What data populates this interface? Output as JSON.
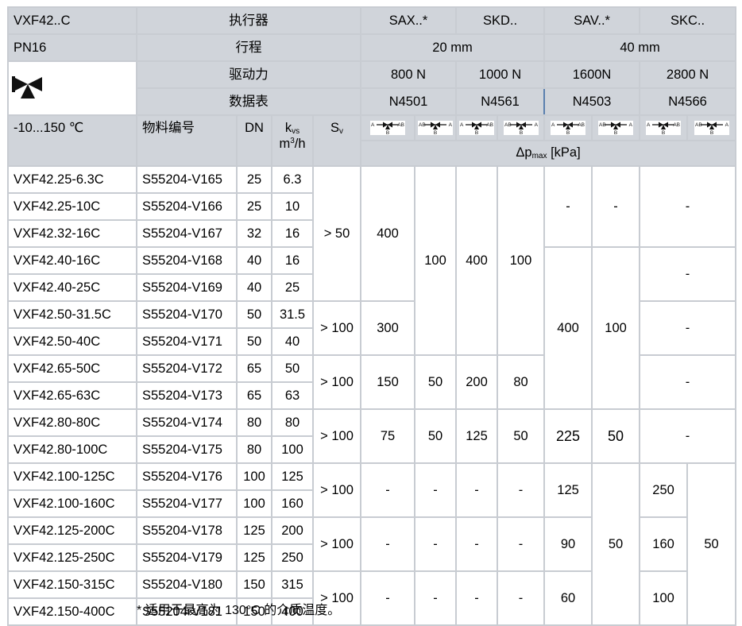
{
  "header": {
    "model": "VXF42..C",
    "actuator_label": "执行器",
    "actuators": [
      "SAX..*",
      "SKD..",
      "SAV..*",
      "SKC.."
    ],
    "pn": "PN16",
    "stroke_label": "行程",
    "strokes": [
      "20 mm",
      "40 mm"
    ],
    "force_label": "驱动力",
    "forces": [
      "800 N",
      "1000 N",
      "1600N",
      "2800 N"
    ],
    "datasheet_label": "数据表",
    "datasheets": [
      "N4501",
      "N4561",
      "N4503",
      "N4566"
    ]
  },
  "columns": {
    "temp": "-10...150 ℃",
    "material": "物料编号",
    "dn": "DN",
    "kvs_main": "k",
    "kvs_sub": "vs",
    "kvs_unit_main": "m",
    "kvs_unit_sup": "3",
    "kvs_unit_tail": "/h",
    "sv_main": "S",
    "sv_sub": "v",
    "dp_delta": "Δp",
    "dp_sub": "max",
    "dp_unit": " [kPa]"
  },
  "flow_icons": {
    "mixing": [
      "A",
      "AB",
      "B"
    ],
    "diverting": [
      "AB",
      "A",
      "B"
    ]
  },
  "rows": [
    {
      "type": "VXF42.25-6.3C",
      "material": "S55204-V165",
      "dn": "25",
      "kvs": "6.3"
    },
    {
      "type": "VXF42.25-10C",
      "material": "S55204-V166",
      "dn": "25",
      "kvs": "10"
    },
    {
      "type": "VXF42.32-16C",
      "material": "S55204-V167",
      "dn": "32",
      "kvs": "16"
    },
    {
      "type": "VXF42.40-16C",
      "material": "S55204-V168",
      "dn": "40",
      "kvs": "16"
    },
    {
      "type": "VXF42.40-25C",
      "material": "S55204-V169",
      "dn": "40",
      "kvs": "25"
    },
    {
      "type": "VXF42.50-31.5C",
      "material": "S55204-V170",
      "dn": "50",
      "kvs": "31.5"
    },
    {
      "type": "VXF42.50-40C",
      "material": "S55204-V171",
      "dn": "50",
      "kvs": "40"
    },
    {
      "type": "VXF42.65-50C",
      "material": "S55204-V172",
      "dn": "65",
      "kvs": "50"
    },
    {
      "type": "VXF42.65-63C",
      "material": "S55204-V173",
      "dn": "65",
      "kvs": "63"
    },
    {
      "type": "VXF42.80-80C",
      "material": "S55204-V174",
      "dn": "80",
      "kvs": "80"
    },
    {
      "type": "VXF42.80-100C",
      "material": "S55204-V175",
      "dn": "80",
      "kvs": "100"
    },
    {
      "type": "VXF42.100-125C",
      "material": "S55204-V176",
      "dn": "100",
      "kvs": "125"
    },
    {
      "type": "VXF42.100-160C",
      "material": "S55204-V177",
      "dn": "100",
      "kvs": "160"
    },
    {
      "type": "VXF42.125-200C",
      "material": "S55204-V178",
      "dn": "125",
      "kvs": "200"
    },
    {
      "type": "VXF42.125-250C",
      "material": "S55204-V179",
      "dn": "125",
      "kvs": "250"
    },
    {
      "type": "VXF42.150-315C",
      "material": "S55204-V180",
      "dn": "150",
      "kvs": "315"
    },
    {
      "type": "VXF42.150-400C",
      "material": "S55204-V181",
      "dn": "150",
      "kvs": "400"
    }
  ],
  "sv": [
    "> 50",
    "> 100",
    "> 100",
    "> 100",
    "> 100",
    "> 100",
    "> 100"
  ],
  "dp": {
    "sax_mix_g1": "400",
    "sax_mix_g2": "300",
    "sax_mix_g3": "150",
    "sax_mix_g4": "75",
    "sax_div_g13": "100",
    "sax_div_g3": "50",
    "sax_div_g4": "50",
    "skd_mix_g13": "400",
    "skd_mix_g3": "200",
    "skd_mix_g4": "125",
    "skd_div_g13": "100",
    "skd_div_g3": "80",
    "skd_div_g4": "50",
    "sav_mix_g1a": "-",
    "sav_div_g1a": "-",
    "skc_g1a": "-",
    "sav_mix_g13": "400",
    "sav_div_g13": "100",
    "skc_g1b": "-",
    "skc_g2": "-",
    "skc_g3": "-",
    "sav_mix_g4": "225",
    "sav_div_g4": "50",
    "skc_g4": "-",
    "dash": "-",
    "sav_mix_g5": "125",
    "sav_mix_g6": "90",
    "sav_mix_g7": "60",
    "sav_div_g57": "50",
    "skc_mix_g5": "250",
    "skc_mix_g6": "160",
    "skc_mix_g7": "100",
    "skc_div_g57": "50"
  },
  "footnote": "* 适用于最高为 130°C 的介质温度。"
}
